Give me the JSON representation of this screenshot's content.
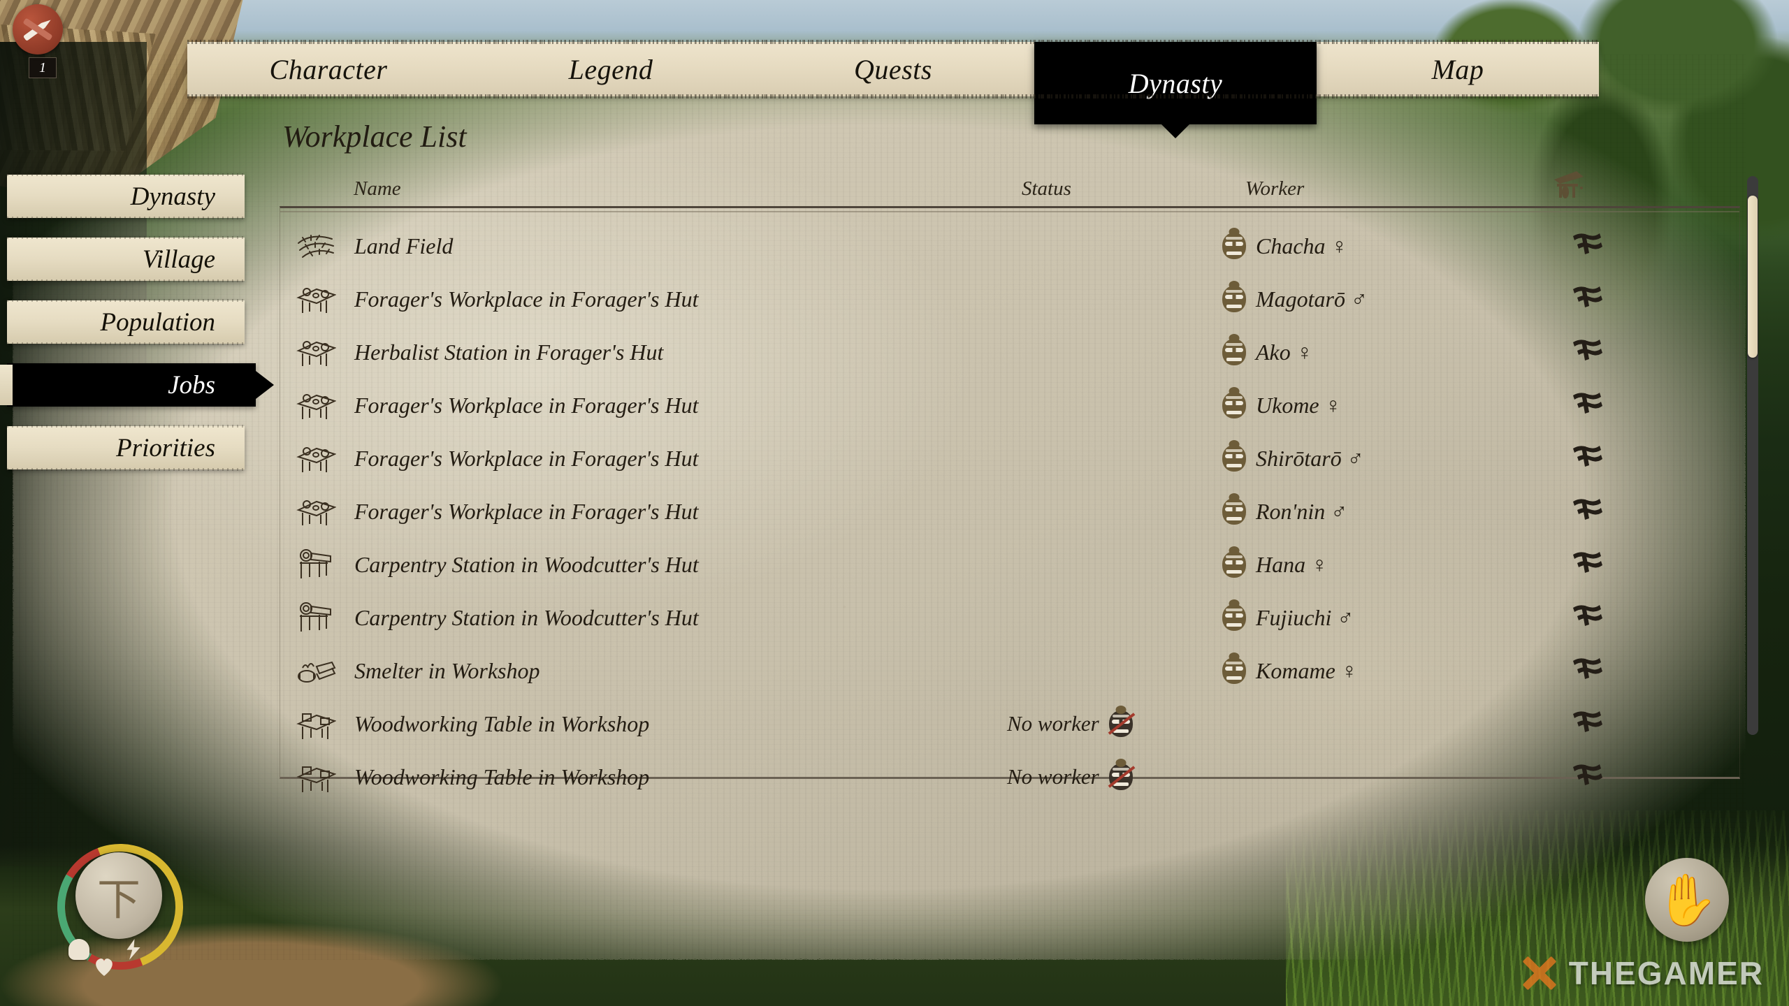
{
  "notification": {
    "count": "1",
    "icon": "crossed-tools-icon"
  },
  "top_tabs": [
    {
      "label": "Character",
      "active": false
    },
    {
      "label": "Legend",
      "active": false
    },
    {
      "label": "Quests",
      "active": false
    },
    {
      "label": "Dynasty",
      "active": true
    },
    {
      "label": "Map",
      "active": false
    }
  ],
  "sidebar": {
    "items": [
      {
        "label": "Dynasty",
        "active": false
      },
      {
        "label": "Village",
        "active": false
      },
      {
        "label": "Population",
        "active": false
      },
      {
        "label": "Jobs",
        "active": true
      },
      {
        "label": "Priorities",
        "active": false
      }
    ]
  },
  "content": {
    "title": "Workplace List",
    "columns": {
      "name": "Name",
      "status": "Status",
      "worker": "Worker",
      "building_icon": "workbench-icon"
    },
    "rows": [
      {
        "icon": "field-icon",
        "name": "Land Field",
        "status": "",
        "worker": "Chacha ♀",
        "has_worker": true,
        "right_icon": "hut-icon"
      },
      {
        "icon": "forager-table-icon",
        "name": "Forager's Workplace in Forager's Hut",
        "status": "",
        "worker": "Magotarō ♂",
        "has_worker": true,
        "right_icon": "hut-icon"
      },
      {
        "icon": "forager-table-icon",
        "name": "Herbalist Station in Forager's Hut",
        "status": "",
        "worker": "Ako ♀",
        "has_worker": true,
        "right_icon": "hut-icon"
      },
      {
        "icon": "forager-table-icon",
        "name": "Forager's Workplace in Forager's Hut",
        "status": "",
        "worker": "Ukome ♀",
        "has_worker": true,
        "right_icon": "hut-icon"
      },
      {
        "icon": "forager-table-icon",
        "name": "Forager's Workplace in Forager's Hut",
        "status": "",
        "worker": "Shirōtarō ♂",
        "has_worker": true,
        "right_icon": "hut-icon"
      },
      {
        "icon": "forager-table-icon",
        "name": "Forager's Workplace in Forager's Hut",
        "status": "",
        "worker": "Ron'nin ♂",
        "has_worker": true,
        "right_icon": "hut-icon"
      },
      {
        "icon": "carpentry-icon",
        "name": "Carpentry Station in Woodcutter's Hut",
        "status": "",
        "worker": "Hana ♀",
        "has_worker": true,
        "right_icon": "hut-icon"
      },
      {
        "icon": "carpentry-icon",
        "name": "Carpentry Station in Woodcutter's Hut",
        "status": "",
        "worker": "Fujiuchi ♂",
        "has_worker": true,
        "right_icon": "hut-icon"
      },
      {
        "icon": "smelter-icon",
        "name": "Smelter in Workshop",
        "status": "",
        "worker": "Komame ♀",
        "has_worker": true,
        "right_icon": "hut-icon"
      },
      {
        "icon": "woodworking-table-icon",
        "name": "Woodworking Table in Workshop",
        "status": "No worker",
        "worker": "",
        "has_worker": false,
        "right_icon": "hut-icon"
      },
      {
        "icon": "woodworking-table-icon",
        "name": "Woodworking Table in Workshop",
        "status": "No worker",
        "worker": "",
        "has_worker": false,
        "right_icon": "hut-icon"
      }
    ]
  },
  "hud": {
    "player_disc_glyph": "下",
    "hand_icon": "open-hand-icon",
    "stat_arcs": [
      {
        "name": "health",
        "color": "#b8392f"
      },
      {
        "name": "stamina",
        "color": "#4aa873"
      },
      {
        "name": "energy",
        "color": "#d8b830"
      }
    ]
  },
  "watermark": {
    "text": "THEGAMER",
    "logo_color": "#e0761f"
  },
  "scrollbar": {
    "position_percent": 4
  }
}
